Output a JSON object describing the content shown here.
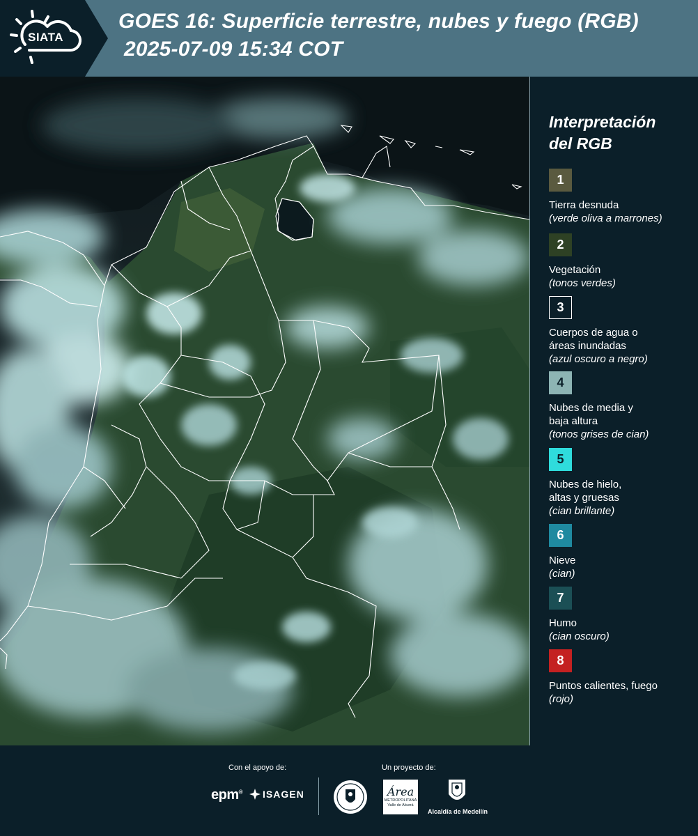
{
  "header": {
    "logo_text": "SIATA",
    "title_line1": "GOES 16: Superficie terrestre, nubes y fuego (RGB)",
    "title_line2": "2025-07-09 15:34 COT"
  },
  "map": {
    "description_icon": "satellite-rgb-composite",
    "colors": {
      "vegetation": "#2a4a30",
      "cloud": "#b7dede",
      "water": "#0a1418",
      "border": "#ffffff"
    }
  },
  "legend": {
    "title_line1": "Interpretación",
    "title_line2": "del RGB",
    "items": [
      {
        "number": "1",
        "label": "Tierra desnuda",
        "desc": "(verde oliva a marrones)",
        "color": "#5a5a3f"
      },
      {
        "number": "2",
        "label": "Vegetación",
        "desc": "(tonos verdes)",
        "color": "#2e4124"
      },
      {
        "number": "3",
        "label": "Cuerpos de agua o áreas inundadas",
        "desc": "(azul oscuro a negro)",
        "color": "#0b1f29"
      },
      {
        "number": "4",
        "label": "Nubes de media y baja altura",
        "desc": "(tonos grises de cian)",
        "color": "#8db4b4"
      },
      {
        "number": "5",
        "label": "Nubes de hielo, altas y gruesas",
        "desc": "(cian brillante)",
        "color": "#2fdcdc"
      },
      {
        "number": "6",
        "label": "Nieve",
        "desc": "(cian)",
        "color": "#1f8aa0"
      },
      {
        "number": "7",
        "label": "Humo",
        "desc": "(cian oscuro)",
        "color": "#1b4f55"
      },
      {
        "number": "8",
        "label": "Puntos calientes, fuego",
        "desc": "(rojo)",
        "color": "#c42121"
      }
    ]
  },
  "footer": {
    "support_label": "Con el apoyo de:",
    "project_label": "Un proyecto de:",
    "sponsor_epm": "epm",
    "sponsor_isagen": "ISAGEN",
    "area_main": "Área",
    "area_sub1": "METROPOLITANA",
    "area_sub2": "Valle de Aburrá",
    "alcaldia": "Alcaldía de Medellín"
  }
}
